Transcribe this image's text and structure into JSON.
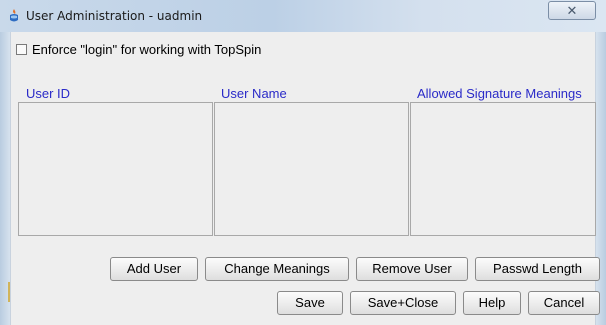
{
  "window": {
    "title": "User Administration - uadmin",
    "close_glyph": "✕"
  },
  "settings": {
    "enforce_login_label": "Enforce \"login\" for working with TopSpin",
    "enforce_login_checked": false
  },
  "table": {
    "columns": [
      "User ID",
      "User Name",
      "Allowed Signature Meanings"
    ]
  },
  "buttons": {
    "row1": [
      "Add User",
      "Change Meanings",
      "Remove User",
      "Passwd Length"
    ],
    "row2": [
      "Save",
      "Save+Close",
      "Help",
      "Cancel"
    ]
  },
  "colors": {
    "header_text": "#2a2ac8",
    "title_bar": "#bcd0e6",
    "dialog_bg": "#eeeeee"
  },
  "icons": {
    "app": "topspin-app-icon",
    "close": "close-icon"
  }
}
